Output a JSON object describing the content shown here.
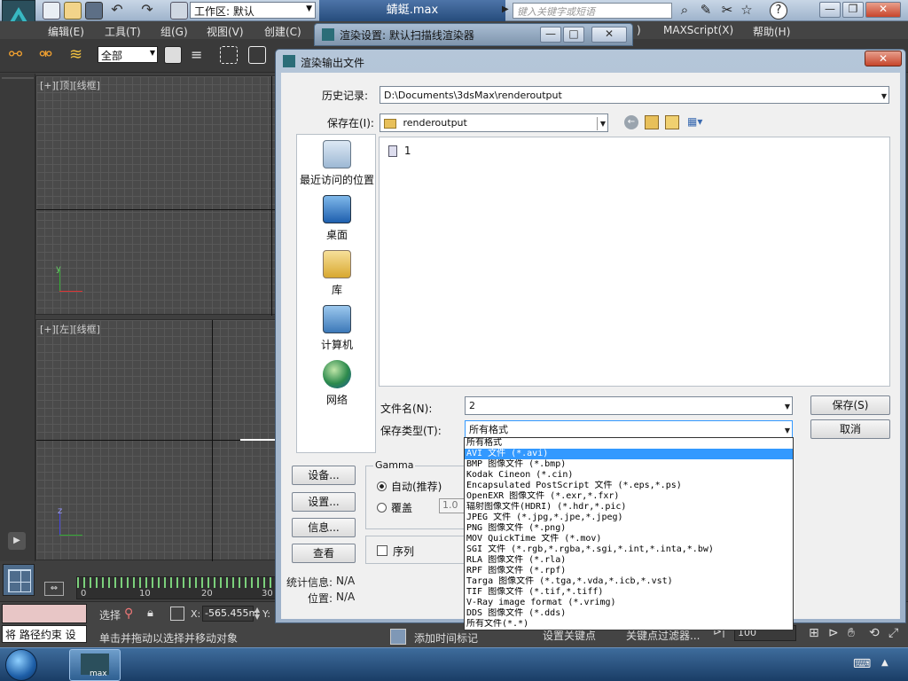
{
  "app": {
    "title": "蜻蜓.max",
    "workspace_label": "工作区: 默认",
    "search_placeholder": "键入关键字或短语",
    "menus": [
      "编辑(E)",
      "工具(T)",
      "组(G)",
      "视图(V)",
      "创建(C)",
      "MAXScript(X)",
      "帮助(H)"
    ],
    "menu_partial": ")",
    "selection_filter": "全部",
    "viewports": {
      "top_label": "[+][顶][线框]",
      "left_label": "[+][左][线框]"
    },
    "timeline_ticks": [
      "0",
      "10",
      "20",
      "30"
    ],
    "status": {
      "constraint_text": "将 路径约束 设",
      "select_label": "选择",
      "x_label": "X:",
      "x_value": "-565.455m",
      "y_label": "Y:",
      "prompt": "单击并拖动以选择并移动对象",
      "add_time_tag": "添加时间标记",
      "set_key": "设置关键点",
      "key_filters": "关键点过滤器...",
      "frame_value": "100"
    },
    "taskbar_app_label": "max"
  },
  "render_setup_window": {
    "title": "渲染设置: 默认扫描线渲染器"
  },
  "dialog": {
    "title": "渲染输出文件",
    "history_label": "历史记录:",
    "history_value": "D:\\Documents\\3dsMax\\renderoutput",
    "save_in_label": "保存在(I):",
    "save_in_value": "renderoutput",
    "places": [
      "最近访问的位置",
      "桌面",
      "库",
      "计算机",
      "网络"
    ],
    "files": [
      "1"
    ],
    "filename_label": "文件名(N):",
    "filename_value": "2",
    "filetype_label": "保存类型(T):",
    "filetype_value": "所有格式",
    "save_button": "保存(S)",
    "cancel_button": "取消",
    "file_types": [
      "所有格式",
      "AVI 文件 (*.avi)",
      "BMP 图像文件 (*.bmp)",
      "Kodak Cineon (*.cin)",
      "Encapsulated PostScript 文件 (*.eps,*.ps)",
      "OpenEXR 图像文件 (*.exr,*.fxr)",
      "辐射图像文件(HDRI) (*.hdr,*.pic)",
      "JPEG 文件 (*.jpg,*.jpe,*.jpeg)",
      "PNG 图像文件 (*.png)",
      "MOV QuickTime 文件 (*.mov)",
      "SGI 文件 (*.rgb,*.rgba,*.sgi,*.int,*.inta,*.bw)",
      "RLA 图像文件 (*.rla)",
      "RPF 图像文件 (*.rpf)",
      "Targa 图像文件 (*.tga,*.vda,*.icb,*.vst)",
      "TIF 图像文件 (*.tif,*.tiff)",
      "V-Ray image format (*.vrimg)",
      "DDS 图像文件 (*.dds)",
      "所有文件(*.*)"
    ],
    "selected_file_type_index": 1,
    "gamma": {
      "title": "Gamma",
      "auto_label": "自动(推荐)",
      "override_label": "覆盖",
      "override_value": "1.0"
    },
    "buttons_left": [
      "设备...",
      "设置...",
      "信息...",
      "查看"
    ],
    "sequence_label": "序列",
    "stats_label": "统计信息:",
    "stats_value": "N/A",
    "location_label": "位置:",
    "location_value": "N/A"
  },
  "colors": {
    "accent": "#3399ff",
    "titlebar": "#7f95ad",
    "dialog_bg": "#f0f0f0"
  }
}
